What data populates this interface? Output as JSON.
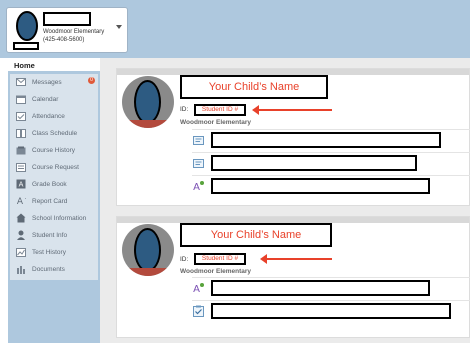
{
  "header": {
    "user_school": "Woodmoor Elementary",
    "user_phone": "(425-408-5600)"
  },
  "sidebar": {
    "home_tab": "Home",
    "messages_badge": "0",
    "items": [
      {
        "label": "Messages",
        "icon": "envelope-icon"
      },
      {
        "label": "Calendar",
        "icon": "calendar-icon"
      },
      {
        "label": "Attendance",
        "icon": "attendance-icon"
      },
      {
        "label": "Class Schedule",
        "icon": "schedule-icon"
      },
      {
        "label": "Course History",
        "icon": "course-history-icon"
      },
      {
        "label": "Course Request",
        "icon": "course-request-icon"
      },
      {
        "label": "Grade Book",
        "icon": "grade-book-icon"
      },
      {
        "label": "Report Card",
        "icon": "report-card-icon"
      },
      {
        "label": "School Information",
        "icon": "school-icon"
      },
      {
        "label": "Student Info",
        "icon": "student-icon"
      },
      {
        "label": "Test History",
        "icon": "test-history-icon"
      },
      {
        "label": "Documents",
        "icon": "documents-icon"
      }
    ]
  },
  "students": [
    {
      "name_placeholder": "Your Child’s Name",
      "id_label": "ID:",
      "id_placeholder": "Student ID #",
      "school": "Woodmoor Elementary",
      "rows": [
        {
          "icon": "announcement-icon"
        },
        {
          "icon": "announcement-icon"
        },
        {
          "icon": "grade-icon"
        }
      ]
    },
    {
      "name_placeholder": "Your Child’s Name",
      "id_label": "ID:",
      "id_placeholder": "Student ID #",
      "school": "Woodmoor Elementary",
      "rows": [
        {
          "icon": "grade-icon"
        },
        {
          "icon": "checklist-icon"
        }
      ]
    }
  ],
  "colors": {
    "sidebar_bg": "#aec8de",
    "annotation_red": "#e8412a",
    "redaction_border": "#000000"
  }
}
